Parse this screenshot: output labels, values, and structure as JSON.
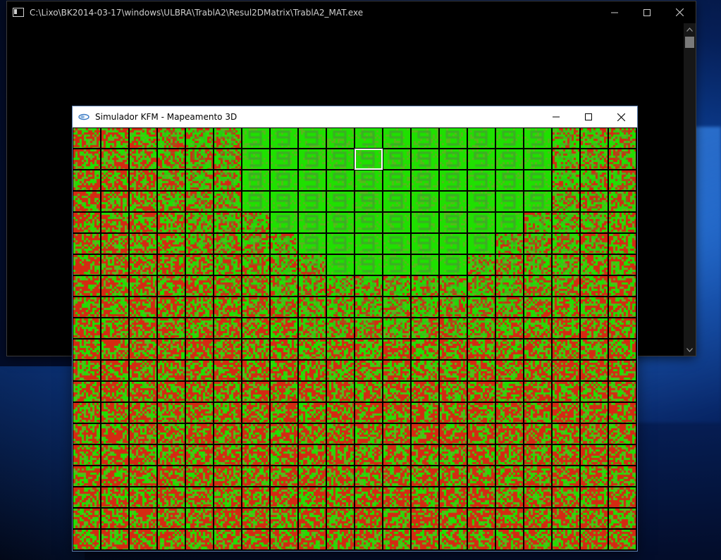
{
  "console_window": {
    "title": "C:\\Lixo\\BK2014-03-17\\windows\\ULBRA\\TrablA2\\Resul2DMatrix\\TrablA2_MAT.exe"
  },
  "simulator_window": {
    "title": "Simulador KFM - Mapeamento 3D"
  },
  "som_map": {
    "columns": 20,
    "rows": 20,
    "selected_cell": {
      "row": 2,
      "col": 11
    },
    "colors": {
      "green": "#1fe000",
      "red": "#d42a12",
      "digit": "#3fa82a"
    },
    "glyph": "9"
  },
  "colors": {
    "console_bg": "#000000",
    "simulator_titlebar": "#ffffff",
    "selection": "#ffffff"
  }
}
